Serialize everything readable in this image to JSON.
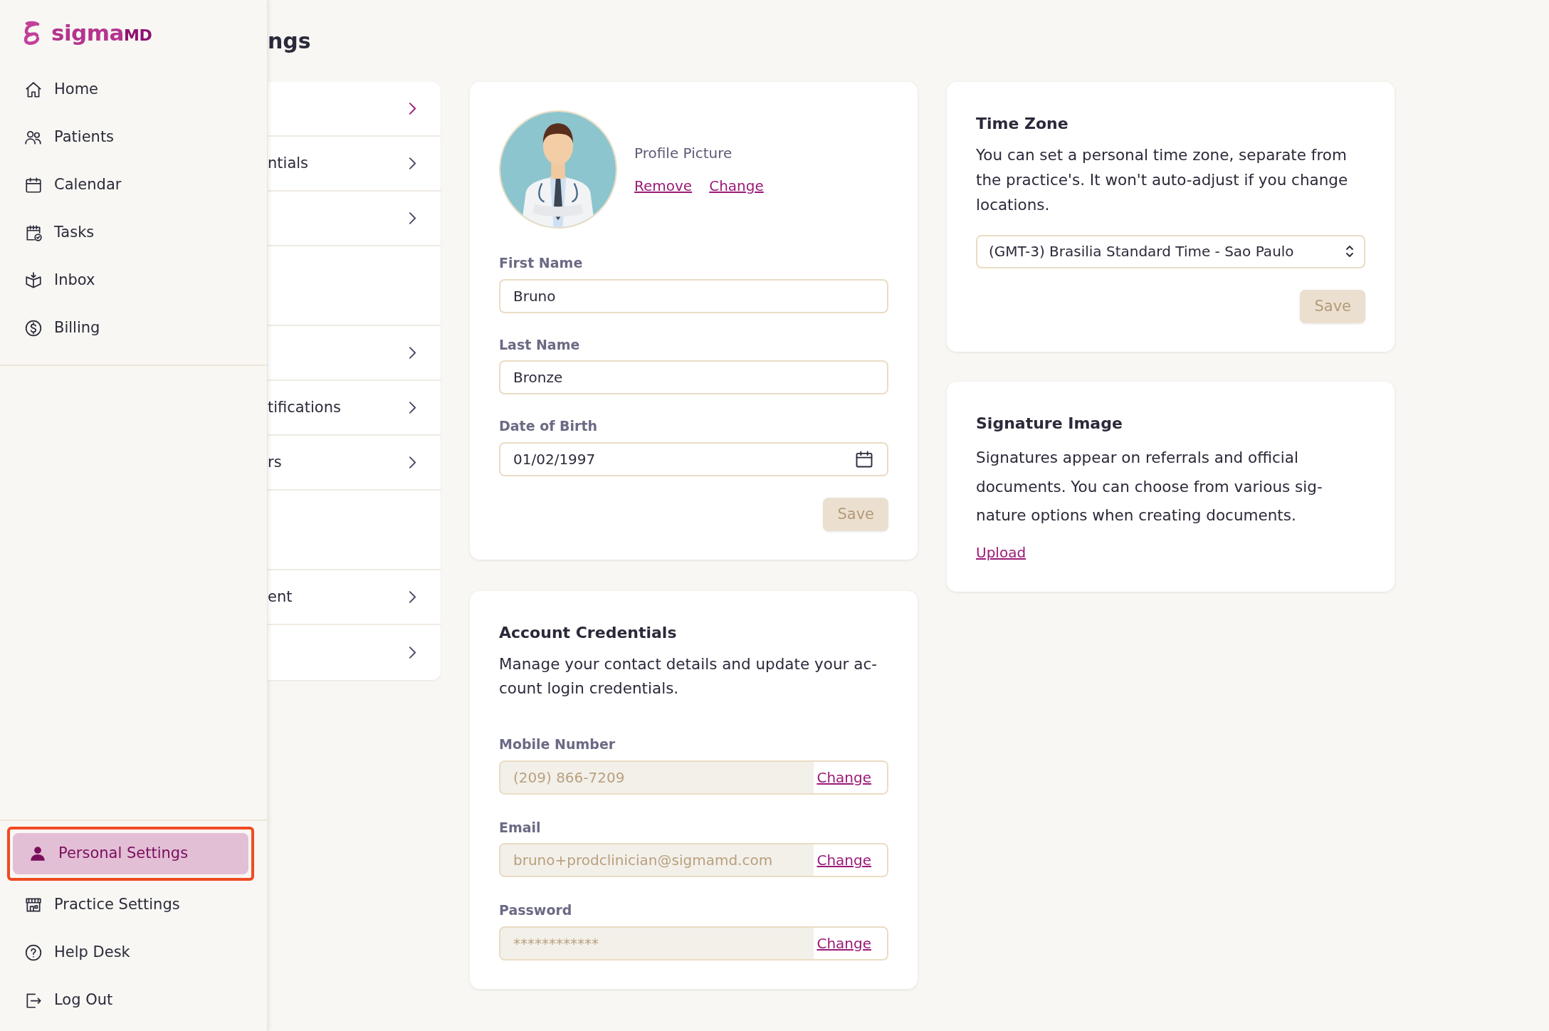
{
  "sidebar": {
    "logo": {
      "text": "sigma",
      "suffix": "MD"
    },
    "nav_items": [
      {
        "label": "Home",
        "selected": false
      },
      {
        "label": "Patients",
        "selected": false
      },
      {
        "label": "Calendar",
        "selected": false
      },
      {
        "label": "Tasks",
        "selected": false
      },
      {
        "label": "Inbox",
        "selected": false
      },
      {
        "label": "Billing",
        "selected": false
      }
    ],
    "footer_items": [
      {
        "label": "Personal Settings",
        "selected": true,
        "outlined": true
      },
      {
        "label": "Practice Settings",
        "selected": false,
        "outlined": false
      },
      {
        "label": "Help Desk",
        "selected": false,
        "outlined": false
      },
      {
        "label": "Log Out",
        "selected": false,
        "outlined": false
      }
    ]
  },
  "page_title": "ngs",
  "settings_menu": [
    {
      "kind": "link",
      "selected": true
    },
    {
      "kind": "link",
      "label": "ntials",
      "selected": false
    },
    {
      "kind": "link",
      "selected": false
    },
    {
      "kind": "spacer"
    },
    {
      "kind": "link",
      "selected": false
    },
    {
      "kind": "link",
      "label": "tifications",
      "selected": false
    },
    {
      "kind": "link",
      "label": "rs",
      "selected": false
    },
    {
      "kind": "spacer"
    },
    {
      "kind": "link",
      "label": "ent",
      "selected": false
    },
    {
      "kind": "link",
      "selected": false
    }
  ],
  "profile": {
    "picture_label": "Profile Picture",
    "remove_link": "Remove",
    "change_link": "Change",
    "fields": [
      {
        "kind": "text",
        "label": "First Name",
        "value": "Bruno"
      },
      {
        "kind": "text",
        "label": "Last Name",
        "value": "Bronze"
      },
      {
        "kind": "date",
        "label": "Date of Birth",
        "value": "01/02/1997"
      }
    ],
    "save_button": {
      "label": "Save",
      "disabled": true
    }
  },
  "account_credentials": {
    "title": "Account Credentials",
    "description": "Manage your contact details and update your ac-count login credentials.",
    "fields": [
      {
        "label": "Mobile Number",
        "value": "(209) 866-7209",
        "disabled": true,
        "action": "Change"
      },
      {
        "label": "Email",
        "value": "bruno+prodclinician@sigmamd.com",
        "disabled": true,
        "action": "Change"
      },
      {
        "label": "Password",
        "value": "************",
        "disabled": true,
        "action": "Change"
      }
    ]
  },
  "time_zone": {
    "title": "Time Zone",
    "description": "You can set a personal time zone, separate from the practice's. It won't auto-adjust if you change locations.",
    "value": "(GMT-3) Brasilia Standard Time - Sao Paulo",
    "save_button": {
      "label": "Save",
      "disabled": true
    }
  },
  "signature": {
    "title": "Signature Image",
    "description": "Signatures appear on referrals and official documents. You can choose from various sig-nature options when creating documents.",
    "upload_link": "Upload"
  }
}
